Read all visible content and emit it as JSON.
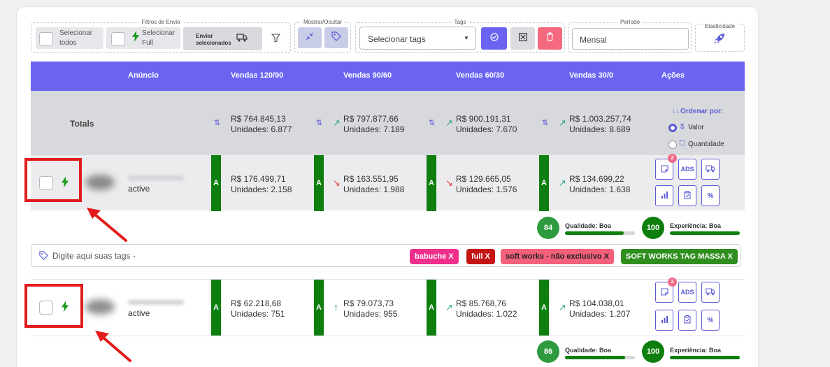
{
  "toolbar": {
    "shipping_filters": {
      "title": "Filtros de Envio",
      "select_all_line1": "Selecionar",
      "select_all_line2": "todos",
      "select_full_line1": "Selecionar",
      "select_full_line2": "Full",
      "send_selected_line1": "Enviar",
      "send_selected_line2": "selecionados"
    },
    "show_hide": {
      "title": "Mostrar/Ocultar"
    },
    "tags": {
      "title": "Tags",
      "select_placeholder": "Selecionar tags"
    },
    "period": {
      "title": "Período",
      "value": "Mensal"
    },
    "elasticity": {
      "title": "Elasticidade"
    }
  },
  "table": {
    "headers": [
      "Anúncio",
      "Vendas 120/90",
      "Vendas 90/60",
      "Vendas 60/30",
      "Vendas 30/0",
      "Ações"
    ],
    "totals": {
      "label": "Totals",
      "cols": [
        {
          "value": "R$ 764.845,13",
          "units": "Unidades: 6.877"
        },
        {
          "value": "R$ 797.877,66",
          "units": "Unidades: 7.189"
        },
        {
          "value": "R$ 900.191,31",
          "units": "Unidades: 7.670"
        },
        {
          "value": "R$ 1.003.257,74",
          "units": "Unidades: 8.689"
        }
      ],
      "order_by": {
        "title": "Ordenar por:",
        "option_value": "Valor",
        "option_quantity": "Quantidade",
        "selected": "Valor"
      }
    },
    "rows": [
      {
        "status": "active",
        "curve": "A",
        "cols": [
          {
            "value": "R$ 176.499,71",
            "units": "Unidades: 2.158",
            "trend": ""
          },
          {
            "value": "R$ 163.551,95",
            "units": "Unidades: 1.988",
            "trend": "down"
          },
          {
            "value": "R$ 129.665,05",
            "units": "Unidades: 1.576",
            "trend": "down"
          },
          {
            "value": "R$ 134.699,22",
            "units": "Unidades: 1.638",
            "trend": "up"
          }
        ],
        "badge_count": "2",
        "ads_label": "ADS",
        "quality": {
          "score": "84",
          "label": "Qualidade: Boa",
          "fraction": 0.84,
          "color": "#2e9a3e"
        },
        "experience": {
          "score": "100",
          "label": "Experiência: Boa",
          "fraction": 1.0,
          "color": "#0e7e0e"
        },
        "tags": {
          "placeholder": "Digite aqui suas tags -",
          "chips": [
            {
              "label": "babuche X",
              "color": "#ef2f8b"
            },
            {
              "label": "full X",
              "color": "#c41414"
            },
            {
              "label": "soft works - não exclusivo X",
              "color": "#f2607b"
            },
            {
              "label": "SOFT WORKS TAG MASSA X",
              "color": "#2f8e1e"
            }
          ]
        }
      },
      {
        "status": "active",
        "curve": "A",
        "cols": [
          {
            "value": "R$ 62.218,68",
            "units": "Unidades: 751",
            "trend": ""
          },
          {
            "value": "R$ 79.073,73",
            "units": "Unidades: 955",
            "trend": "up-strong"
          },
          {
            "value": "R$ 85.768,76",
            "units": "Unidades: 1.022",
            "trend": "up"
          },
          {
            "value": "R$ 104.038,01",
            "units": "Unidades: 1.207",
            "trend": "up"
          }
        ],
        "badge_count": "2",
        "ads_label": "ADS",
        "quality": {
          "score": "86",
          "label": "Qualidade: Boa",
          "fraction": 0.86,
          "color": "#2e9a3e"
        },
        "experience": {
          "score": "100",
          "label": "Experiência: Boa",
          "fraction": 1.0,
          "color": "#0e7e0e"
        }
      }
    ]
  },
  "colors": {
    "header": "#6a64f1",
    "curve_green": "#0e7e0e",
    "action_blue": "#5959d6",
    "delete_red": "#f56a7e",
    "highlight_red": "#e21c1c"
  }
}
